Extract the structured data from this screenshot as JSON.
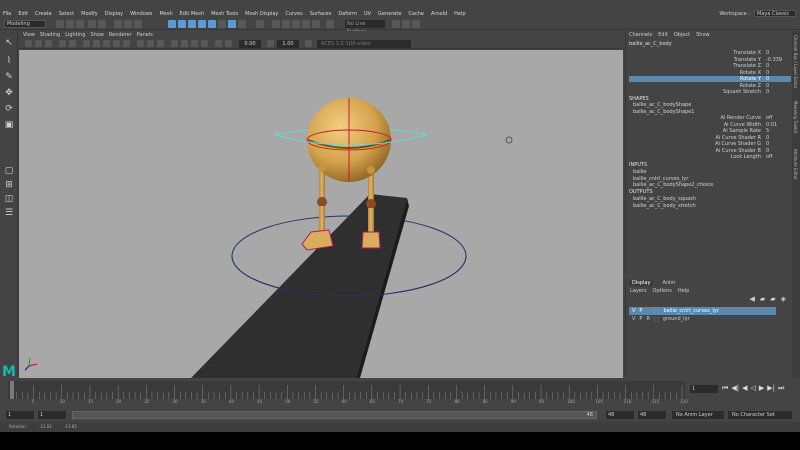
{
  "menubar": {
    "items": [
      "File",
      "Edit",
      "Create",
      "Select",
      "Modify",
      "Display",
      "Windows",
      "Mesh",
      "Edit Mesh",
      "Mesh Tools",
      "Mesh Display",
      "Curves",
      "Surfaces",
      "Deform",
      "UV",
      "Generate",
      "Cache",
      "Arnold",
      "Help"
    ],
    "workspace_label": "Workspace :",
    "workspace_value": "Maya Classic"
  },
  "statusline": {
    "mode": "Modeling",
    "surface_field": "No Live Surface"
  },
  "viewport": {
    "menu": [
      "View",
      "Shading",
      "Lighting",
      "Show",
      "Renderer",
      "Panels"
    ],
    "field_a": "0.00",
    "field_b": "1.00",
    "field_c": "ACES 1.0 SDR-video"
  },
  "channelbox": {
    "menu": [
      "Channels",
      "Edit",
      "Object",
      "Show"
    ],
    "node_name": "ballie_ac_C_body",
    "attributes": [
      {
        "name": "Translate X",
        "value": "0"
      },
      {
        "name": "Translate Y",
        "value": "-0.339"
      },
      {
        "name": "Translate Z",
        "value": "0"
      },
      {
        "name": "Rotate X",
        "value": "0"
      },
      {
        "name": "Rotate Y",
        "value": "0"
      },
      {
        "name": "Rotate Z",
        "value": "0"
      },
      {
        "name": "Squash Stretch",
        "value": "0"
      }
    ],
    "shapes_title": "SHAPES",
    "shapes": [
      "ballie_ac_C_bodyShape",
      "ballie_ac_C_bodyShape1"
    ],
    "shape_attrs": [
      {
        "name": "Ai Render Curve",
        "value": "off"
      },
      {
        "name": "Ai Curve Width",
        "value": "0.01"
      },
      {
        "name": "Ai Sample Rate",
        "value": "5"
      },
      {
        "name": "Ai Curve Shader R",
        "value": "0"
      },
      {
        "name": "Ai Curve Shader G",
        "value": "0"
      },
      {
        "name": "Ai Curve Shader B",
        "value": "0"
      },
      {
        "name": "Lock Length",
        "value": "off"
      }
    ],
    "inputs_title": "INPUTS",
    "inputs": [
      "ballie",
      "ballie_cntrl_curves_lyr",
      "ballie_ac_C_bodyShape2_choice"
    ],
    "outputs_title": "OUTPUTS",
    "outputs": [
      "ballie_ac_C_body_squash",
      "ballie_ac_C_body_stretch"
    ]
  },
  "side_tabs": [
    "Channel Box / Layer Editor",
    "Modeling Toolkit",
    "Attribute Editor"
  ],
  "layer_editor": {
    "tabs": [
      "Display",
      "Anim"
    ],
    "menu": [
      "Layers",
      "Options",
      "Help"
    ],
    "layers": [
      {
        "v": "V",
        "p": "P",
        "r": "",
        "name": "ballie_cntrl_curves_lyr",
        "selected": true
      },
      {
        "v": "V",
        "p": "P",
        "r": "R",
        "name": "ground_lyr",
        "selected": false
      }
    ]
  },
  "timeslider": {
    "labels": [
      "5",
      "10",
      "15",
      "20",
      "25",
      "30",
      "35",
      "40",
      "45",
      "50",
      "55",
      "60",
      "65",
      "70",
      "75",
      "80",
      "85",
      "90",
      "95",
      "100",
      "105",
      "110",
      "115",
      "120"
    ],
    "current": "1"
  },
  "rangeslider": {
    "start": "1",
    "start_inner": "1",
    "end_inner": "48",
    "end_field": "48",
    "end_outer": "48",
    "anim_layer": "No Anim Layer",
    "char_set": "No Character Set"
  },
  "helpline": {
    "items": [
      "Rotation:",
      "-21.82",
      "-13.85"
    ]
  },
  "colors": {
    "viewport_bg": "#a8a8a8",
    "selection": "#5b88ad",
    "body_gold": "#d4a24c",
    "curve_red": "#c0202a",
    "ring_cyan": "#6fd7d0"
  }
}
